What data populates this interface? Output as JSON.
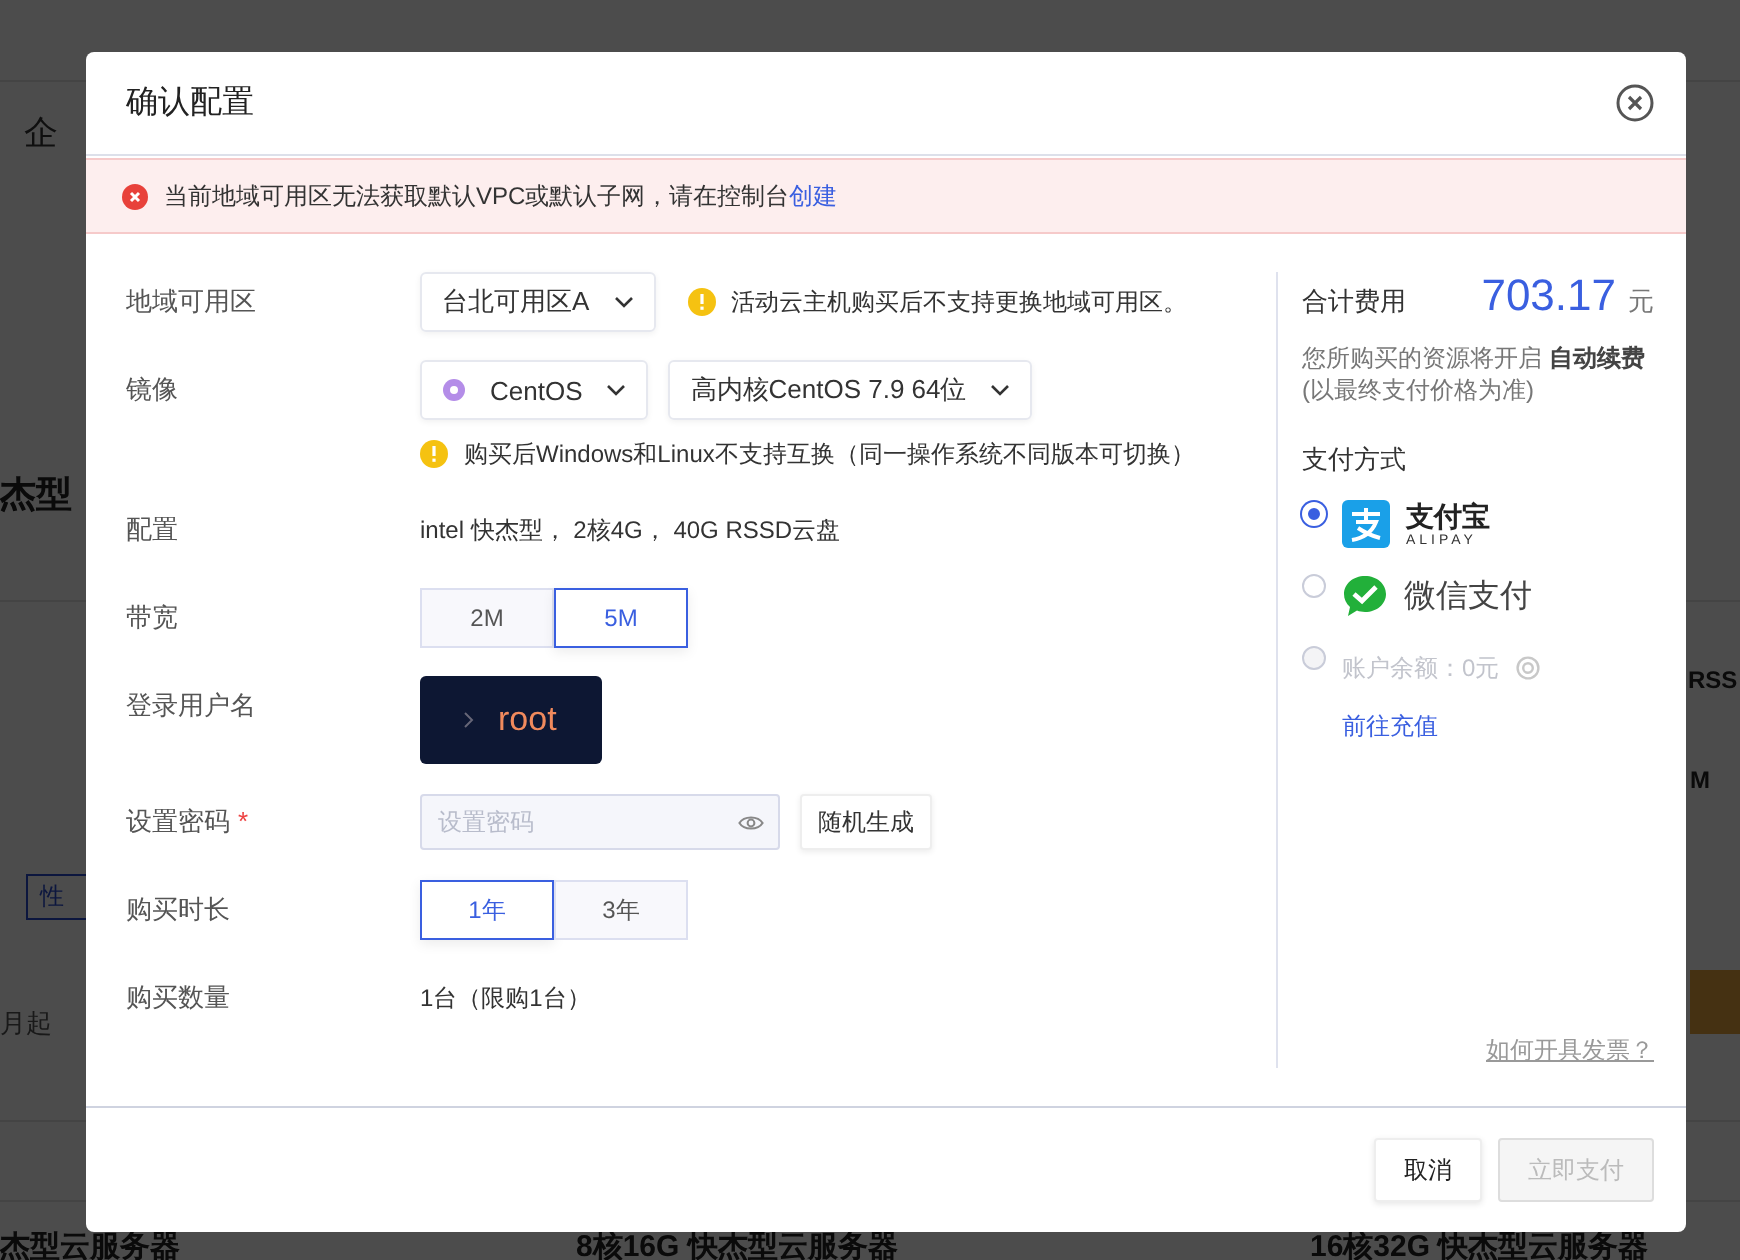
{
  "background": {
    "texts": [
      {
        "kind": "nav",
        "text": "企"
      },
      {
        "kind": "heading",
        "text": "杰型"
      },
      {
        "kind": "tag",
        "text": "性"
      },
      {
        "kind": "plain",
        "text": "月起"
      },
      {
        "kind": "bold",
        "text": "RSS"
      },
      {
        "kind": "bold",
        "text": "M"
      },
      {
        "kind": "card",
        "text": "杰型云服务器"
      },
      {
        "kind": "card",
        "text": "8核16G 快杰型云服务器"
      },
      {
        "kind": "card",
        "text": "16核32G 快杰型云服务器"
      }
    ]
  },
  "dialog": {
    "title": "确认配置"
  },
  "alert": {
    "message": "当前地域可用区无法获取默认VPC或默认子网，请在控制台",
    "link": "创建"
  },
  "form": {
    "rows": [
      {
        "kind": "selects",
        "label": "地域可用区",
        "selects": [
          {
            "kind": "plain",
            "value": "台北可用区A"
          }
        ],
        "tip": "活动云主机购买后不支持更换地域可用区。"
      },
      {
        "kind": "selects",
        "label": "镜像",
        "selects": [
          {
            "kind": "os",
            "value": "CentOS"
          },
          {
            "kind": "plain",
            "value": "高内核CentOS 7.9 64位"
          }
        ],
        "note": "购买后Windows和Linux不支持互换（同一操作系统不同版本可切换）"
      },
      {
        "kind": "text",
        "label": "配置",
        "value": "intel 快杰型， 2核4G， 40G RSSD云盘"
      },
      {
        "kind": "segmented",
        "label": "带宽",
        "options": [
          {
            "label": "2M",
            "selected": false
          },
          {
            "label": "5M",
            "selected": true
          }
        ]
      },
      {
        "kind": "terminal",
        "label": "登录用户名",
        "value": "root"
      },
      {
        "kind": "password",
        "label": "设置密码",
        "required_mark": "*",
        "placeholder": "设置密码",
        "button": "随机生成"
      },
      {
        "kind": "segmented",
        "label": "购买时长",
        "options": [
          {
            "label": "1年",
            "selected": true
          },
          {
            "label": "3年",
            "selected": false
          }
        ]
      },
      {
        "kind": "text",
        "label": "购买数量",
        "value": "1台（限购1台）"
      }
    ]
  },
  "summary": {
    "total_label": "合计费用",
    "amount": "703.17",
    "currency": "元",
    "renew_note": "您所购买的资源将开启 **自动续费**",
    "renew_hint": "(以最终支付价格为准)"
  },
  "payment": {
    "title": "支付方式",
    "methods": [
      {
        "kind": "alipay",
        "label": "支付宝",
        "sublabel": "ALIPAY",
        "selected": true,
        "disabled": false
      },
      {
        "kind": "wechat",
        "label": "微信支付",
        "selected": false,
        "disabled": false
      },
      {
        "kind": "balance",
        "label": "账户余额：0元",
        "selected": false,
        "disabled": true
      }
    ],
    "recharge_link": "前往充值"
  },
  "invoice_link": "如何开具发票？",
  "footer": {
    "buttons": [
      {
        "label": "取消",
        "disabled": false
      },
      {
        "label": "立即支付",
        "disabled": true
      }
    ]
  }
}
